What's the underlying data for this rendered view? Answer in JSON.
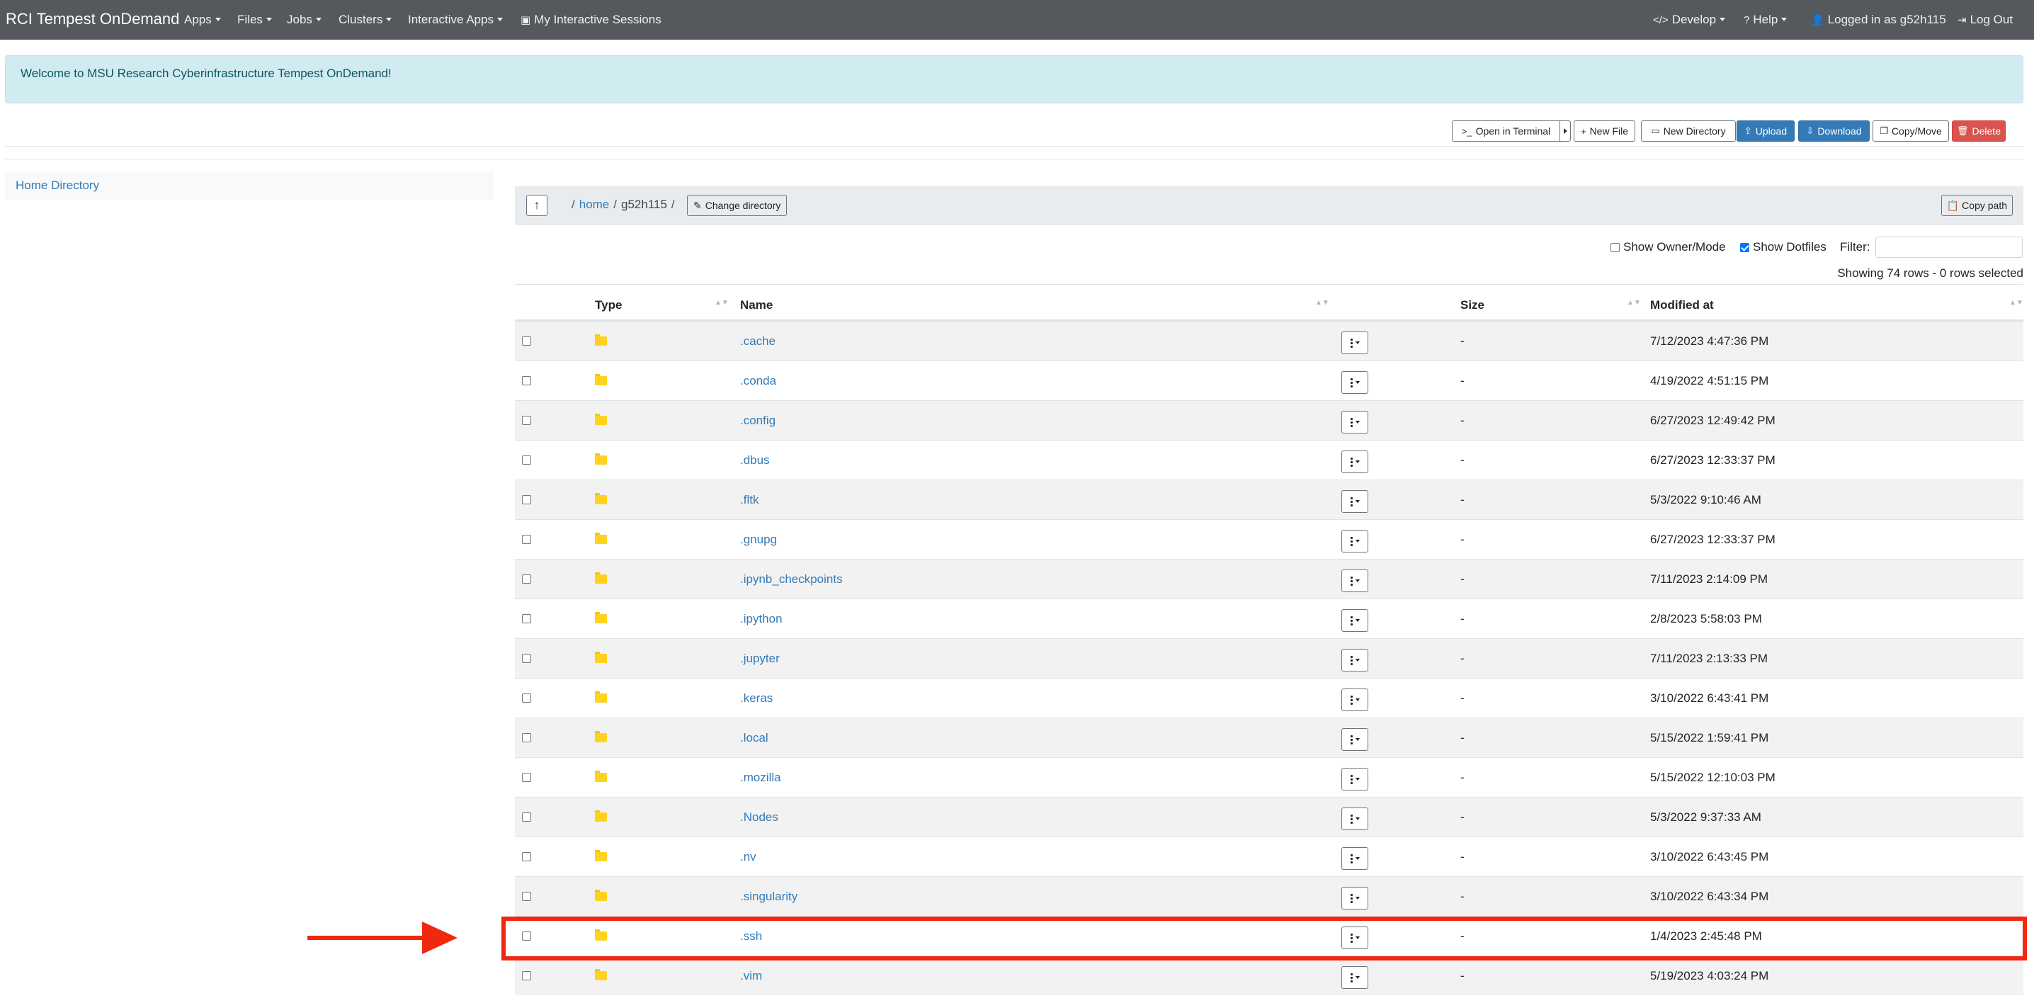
{
  "navbar": {
    "brand": "RCI Tempest OnDemand",
    "menus": [
      "Apps",
      "Files",
      "Jobs",
      "Clusters",
      "Interactive Apps"
    ],
    "sessions": "My Interactive Sessions",
    "develop": "Develop",
    "help": "Help",
    "logged_in": "Logged in as g52h115",
    "logout": "Log Out"
  },
  "alert": {
    "text": "Welcome to MSU Research Cyberinfrastructure Tempest OnDemand!"
  },
  "toolbar": {
    "open_terminal": "Open in Terminal",
    "new_file": "New File",
    "new_directory": "New Directory",
    "upload": "Upload",
    "download": "Download",
    "copy_move": "Copy/Move",
    "delete": "Delete"
  },
  "sidebar": {
    "home_directory": "Home Directory"
  },
  "path": {
    "root_sep": "/",
    "home": "home",
    "sep": "/",
    "current": "g52h115",
    "trailing_sep": "/",
    "change_directory": "Change directory",
    "copy_path": "Copy path"
  },
  "options": {
    "show_owner_mode": "Show Owner/Mode",
    "show_owner_mode_checked": false,
    "show_dotfiles": "Show Dotfiles",
    "show_dotfiles_checked": true,
    "filter_label": "Filter:",
    "filter_value": "",
    "showing": "Showing 74 rows - 0 rows selected"
  },
  "table": {
    "headers": {
      "type": "Type",
      "name": "Name",
      "size": "Size",
      "modified": "Modified at"
    },
    "rows": [
      {
        "name": ".cache",
        "size": "-",
        "modified": "7/12/2023 4:47:36 PM"
      },
      {
        "name": ".conda",
        "size": "-",
        "modified": "4/19/2022 4:51:15 PM"
      },
      {
        "name": ".config",
        "size": "-",
        "modified": "6/27/2023 12:49:42 PM"
      },
      {
        "name": ".dbus",
        "size": "-",
        "modified": "6/27/2023 12:33:37 PM"
      },
      {
        "name": ".fltk",
        "size": "-",
        "modified": "5/3/2022 9:10:46 AM"
      },
      {
        "name": ".gnupg",
        "size": "-",
        "modified": "6/27/2023 12:33:37 PM"
      },
      {
        "name": ".ipynb_checkpoints",
        "size": "-",
        "modified": "7/11/2023 2:14:09 PM"
      },
      {
        "name": ".ipython",
        "size": "-",
        "modified": "2/8/2023 5:58:03 PM"
      },
      {
        "name": ".jupyter",
        "size": "-",
        "modified": "7/11/2023 2:13:33 PM"
      },
      {
        "name": ".keras",
        "size": "-",
        "modified": "3/10/2022 6:43:41 PM"
      },
      {
        "name": ".local",
        "size": "-",
        "modified": "5/15/2022 1:59:41 PM"
      },
      {
        "name": ".mozilla",
        "size": "-",
        "modified": "5/15/2022 12:10:03 PM"
      },
      {
        "name": ".Nodes",
        "size": "-",
        "modified": "5/3/2022 9:37:33 AM"
      },
      {
        "name": ".nv",
        "size": "-",
        "modified": "3/10/2022 6:43:45 PM"
      },
      {
        "name": ".singularity",
        "size": "-",
        "modified": "3/10/2022 6:43:34 PM"
      },
      {
        "name": ".ssh",
        "size": "-",
        "modified": "1/4/2023 2:45:48 PM"
      },
      {
        "name": ".vim",
        "size": "-",
        "modified": "5/19/2023 4:03:24 PM"
      }
    ]
  },
  "colors": {
    "navbar": "#55585c",
    "link": "#337ab7",
    "primary": "#337ab7",
    "danger": "#d9534f",
    "folder": "#ffd21f",
    "annotation": "#f02810"
  }
}
